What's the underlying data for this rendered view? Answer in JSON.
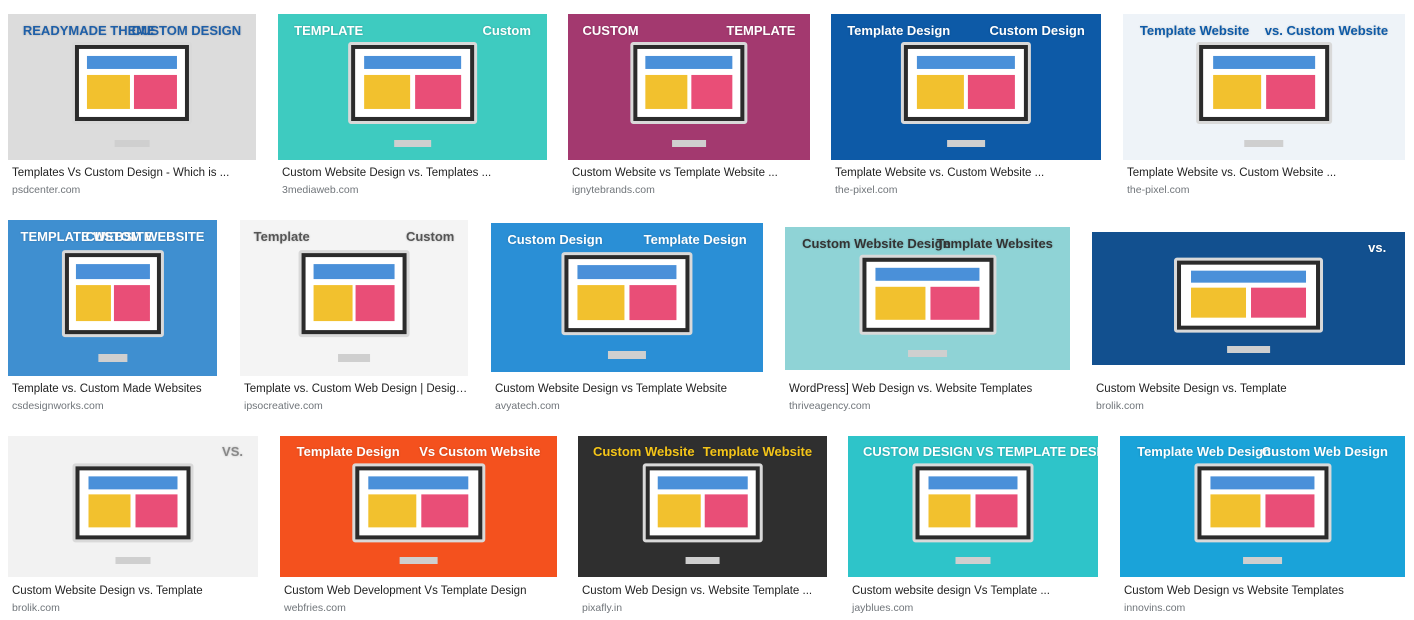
{
  "results": [
    {
      "title": "Templates Vs Custom Design - Which is ...",
      "domain": "psdcenter.com",
      "bg": "#dcdcdc",
      "fg": "#1e5fa8",
      "t1": "READYMADE THEME",
      "t2": "CUSTOM DESIGN"
    },
    {
      "title": "Custom Website Design vs. Templates ...",
      "domain": "3mediaweb.com",
      "bg": "#3ecbc0",
      "fg": "#ffffff",
      "t1": "TEMPLATE",
      "t2": "Custom"
    },
    {
      "title": "Custom Website vs Template Website ...",
      "domain": "ignytebrands.com",
      "bg": "#a3396f",
      "fg": "#ffffff",
      "t1": "CUSTOM",
      "t2": "TEMPLATE"
    },
    {
      "title": "Template Website vs. Custom Website ...",
      "domain": "the-pixel.com",
      "bg": "#0d5aa7",
      "fg": "#ffffff",
      "t1": "Template Design",
      "t2": "Custom Design"
    },
    {
      "title": "Template Website vs. Custom Website ...",
      "domain": "the-pixel.com",
      "bg": "#eef3f8",
      "fg": "#0d5aa7",
      "t1": "Template Website",
      "t2": "vs. Custom Website"
    },
    {
      "title": "Template vs. Custom Made Websites",
      "domain": "csdesignworks.com",
      "bg": "#3f8fd0",
      "fg": "#ffffff",
      "t1": "TEMPLATE WEBSITE",
      "t2": "CUSTOM WEBSITE"
    },
    {
      "title": "Template vs. Custom Web Design | Design ...",
      "domain": "ipsocreative.com",
      "bg": "#f4f4f4",
      "fg": "#555555",
      "t1": "Template",
      "t2": "Custom"
    },
    {
      "title": "Custom Website Design vs Template Website",
      "domain": "avyatech.com",
      "bg": "#2a8fd6",
      "fg": "#ffffff",
      "t1": "Custom Design",
      "t2": "Template Design"
    },
    {
      "title": "WordPress] Web Design vs. Website Templates",
      "domain": "thriveagency.com",
      "bg": "#8fd3d6",
      "fg": "#333333",
      "t1": "Custom Website Design",
      "t2": "Template Websites"
    },
    {
      "title": "Custom Website Design vs. Template",
      "domain": "brolik.com",
      "bg": "#12508f",
      "fg": "#ffffff",
      "t1": "",
      "t2": "vs."
    },
    {
      "title": "Custom Website Design vs. Template",
      "domain": "brolik.com",
      "bg": "#f2f2f2",
      "fg": "#888888",
      "t1": "",
      "t2": "VS."
    },
    {
      "title": "Custom Web Development Vs Template Design",
      "domain": "webfries.com",
      "bg": "#f4511e",
      "fg": "#ffffff",
      "t1": "Template Design",
      "t2": "Vs Custom Website"
    },
    {
      "title": "Custom Web Design vs. Website Template ...",
      "domain": "pixafly.in",
      "bg": "#2f2f2f",
      "fg": "#f5c518",
      "t1": "Custom Website",
      "t2": "Template Website"
    },
    {
      "title": "Custom website design Vs Template ...",
      "domain": "jayblues.com",
      "bg": "#2ec4c9",
      "fg": "#ffffff",
      "t1": "CUSTOM DESIGN VS TEMPLATE DESIGN",
      "t2": ""
    },
    {
      "title": "Custom Web Design vs Website Templates",
      "domain": "innovins.com",
      "bg": "#1aa3d9",
      "fg": "#ffffff",
      "t1": "Template Web Design",
      "t2": "Custom Web Design"
    }
  ]
}
